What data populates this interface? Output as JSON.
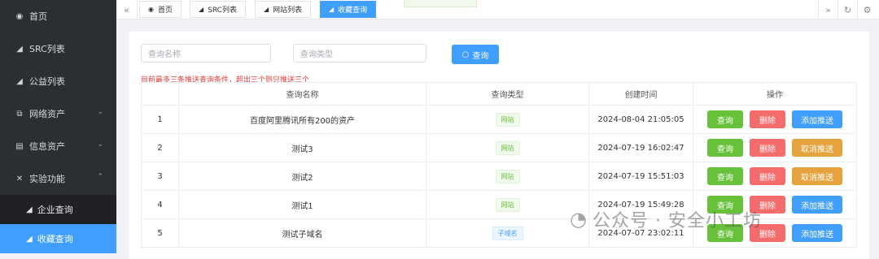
{
  "sidebar": {
    "items": [
      {
        "label": "首页",
        "icon": "dashboard-icon"
      },
      {
        "label": "SRC列表",
        "icon": "send-icon"
      },
      {
        "label": "公益列表",
        "icon": "send-icon"
      },
      {
        "label": "网络资产",
        "icon": "network-icon"
      },
      {
        "label": "信息资产",
        "icon": "document-icon"
      },
      {
        "label": "实验功能",
        "icon": "tools-icon"
      }
    ],
    "sub_items": [
      {
        "label": "企业查询",
        "icon": "send-icon"
      },
      {
        "label": "收藏查询",
        "icon": "send-icon",
        "active": true
      }
    ]
  },
  "tabs": [
    {
      "label": "首页"
    },
    {
      "label": "SRC列表"
    },
    {
      "label": "网站列表"
    },
    {
      "label": "收藏查询",
      "active": true
    }
  ],
  "search": {
    "name_placeholder": "查询名称",
    "type_placeholder": "查询类型",
    "button_label": "查询",
    "notice": "目前最多三条推送查询条件，超出三个则只推送三个"
  },
  "table": {
    "headers": [
      "",
      "查询名称",
      "查询类型",
      "创建时间",
      "操作"
    ],
    "rows": [
      {
        "idx": "1",
        "name": "百度阿里腾讯所有200的资产",
        "type": "网站",
        "time": "2024-08-04 21:05:05",
        "push": "添加推送"
      },
      {
        "idx": "2",
        "name": "测试3",
        "type": "网站",
        "time": "2024-07-19 16:02:47",
        "push": "取消推送"
      },
      {
        "idx": "3",
        "name": "测试2",
        "type": "网站",
        "time": "2024-07-19 15:51:03",
        "push": "取消推送"
      },
      {
        "idx": "4",
        "name": "测试1",
        "type": "网站",
        "time": "2024-07-19 15:49:28",
        "push": "添加推送"
      },
      {
        "idx": "5",
        "name": "测试子域名",
        "type": "子域名",
        "time": "2024-07-07 23:02:11",
        "push": "添加推送"
      }
    ],
    "query_label": "查询",
    "delete_label": "删除"
  },
  "watermark": "公众号 · 安全小工坊",
  "colors": {
    "primary": "#409eff",
    "success": "#67c23a",
    "danger": "#f56c6c",
    "warning": "#e6a23c",
    "sidebar_bg": "#2b2e33"
  }
}
